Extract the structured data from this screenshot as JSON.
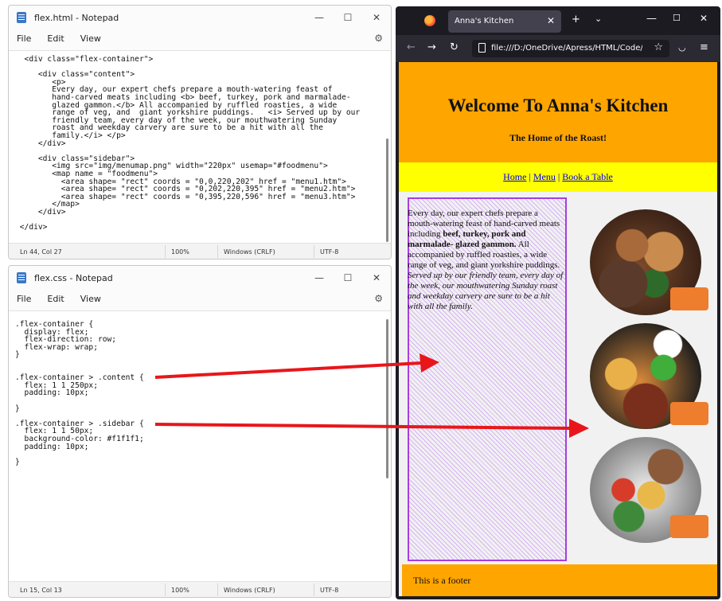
{
  "notepad_html": {
    "title": "flex.html - Notepad",
    "menu": [
      "File",
      "Edit",
      "View"
    ],
    "code": "  <div class=\"flex-container\">\n\n     <div class=\"content\">\n        <p>\n        Every day, our expert chefs prepare a mouth-watering feast of\n        hand-carved meats including <b> beef, turkey, pork and marmalade-\n        glazed gammon.</b> All accompanied by ruffled roasties, a wide\n        range of veg, and  giant yorkshire puddings.   <i> Served up by our\n        friendly team, every day of the week, our mouthwatering Sunday\n        roast and weekday carvery are sure to be a hit with all the\n        family.</i> </p>\n     </div>\n\n     <div class=\"sidebar\">\n        <img src=\"img/menumap.png\" width=\"220px\" usemap=\"#foodmenu\">\n        <map name = \"foodmenu\">\n          <area shape= \"rect\" coords = \"0,0,220,202\" href = \"menu1.htm\">\n          <area shape= \"rect\" coords = \"0,202,220,395\" href = \"menu2.htm\">\n          <area shape= \"rect\" coords = \"0,395,220,596\" href = \"menu3.htm\">\n        </map>\n     </div>\n\n </div>",
    "status": {
      "position": "Ln 44, Col 27",
      "zoom": "100%",
      "line_ending": "Windows (CRLF)",
      "encoding": "UTF-8"
    }
  },
  "notepad_css": {
    "title": "flex.css - Notepad",
    "menu": [
      "File",
      "Edit",
      "View"
    ],
    "code": ".flex-container {\n  display: flex;\n  flex-direction: row;\n  flex-wrap: wrap;\n}\n\n\n.flex-container > .content {\n  flex: 1 1 250px;\n  padding: 10px;\n\n}\n\n.flex-container > .sidebar {\n  flex: 1 1 50px;\n  background-color: #f1f1f1;\n  padding: 10px;\n\n}",
    "status": {
      "position": "Ln 15, Col 13",
      "zoom": "100%",
      "line_ending": "Windows (CRLF)",
      "encoding": "UTF-8"
    }
  },
  "browser": {
    "tab_title": "Anna's Kitchen",
    "url": "file:///D:/OneDrive/Apress/HTML/Code/",
    "page": {
      "heading": "Welcome To Anna's Kitchen",
      "subheading": "The Home of the Roast!",
      "nav": [
        "Home",
        "Menu",
        "Book a Table"
      ],
      "content": {
        "intro": "Every day, our expert chefs prepare a mouth-watering feast of hand-carved meats including ",
        "bold": "beef, turkey, pork and marmalade- glazed gammon.",
        "middle": " All accompanied by ruffled roasties, a wide range of veg, and giant yorkshire puddings. ",
        "italic": "Served up by our friendly team, every day of the week, our mouthwatering Sunday roast and weekday carvery are sure to be a hit with all the family."
      },
      "footer": "This is a footer"
    }
  },
  "colors": {
    "header": "#ffa500",
    "nav": "#ffff00",
    "content_border": "#a53fe0",
    "sidebar_bg": "#f1f1f1",
    "arrow": "#e8161b",
    "food_button": "#ee7d2e"
  }
}
